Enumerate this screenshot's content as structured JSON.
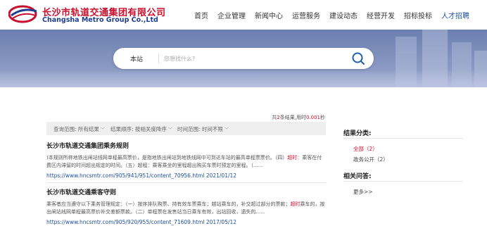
{
  "header": {
    "logo_cn": "长沙市轨道交通集团有限公司",
    "logo_en": "Changsha Metro Group Co.,Ltd",
    "nav": [
      {
        "label": "首页",
        "active": false
      },
      {
        "label": "企业管理",
        "active": false
      },
      {
        "label": "新闻中心",
        "active": false
      },
      {
        "label": "运营服务",
        "active": false
      },
      {
        "label": "建设动态",
        "active": false
      },
      {
        "label": "经营开发",
        "active": false
      },
      {
        "label": "招标投标",
        "active": false
      },
      {
        "label": "人才招聘",
        "active": true
      }
    ]
  },
  "search": {
    "scope": "本站",
    "placeholder": "您想找什么?",
    "button_icon": "search-icon"
  },
  "results_meta": {
    "prefix": "共",
    "count": "2",
    "middle": "条结果,用时",
    "time": "0.001",
    "suffix": "秒"
  },
  "filters": [
    {
      "label": "查询范围:",
      "value": "所有结果"
    },
    {
      "label": "结果顺序:",
      "value": "按相关度降序"
    },
    {
      "label": "时间范围:",
      "value": "时间不限"
    }
  ],
  "results": [
    {
      "title": "长沙市轨道交通集团乘务规则",
      "snippet_parts": [
        {
          "text": ")本规则所称地铁出闸站线网单程最高票价，是指地铁出闸站到地铁线网中可到达车站的最高单程票票价。（四）",
          "hl": false
        },
        {
          "text": "超时",
          "hl": true
        },
        {
          "text": "：乘客在付费区内滞留的时间超出规定的时间。（五）超程：乘客乘坐的里程超出购买车票时预定的里程。（......",
          "hl": false
        }
      ],
      "url": "https://www.hncsmtr.com/905/941/951/content_70956.html",
      "date": "2021/01/12"
    },
    {
      "title": "长沙市轨道交通乘客守则",
      "snippet_parts": [
        {
          "text": "乘客者应当遵守以下乘务管理规定：（一）按序排队购票、持有效车票乘车；越站乘车的，补交超过部分的票款；",
          "hl": false
        },
        {
          "text": "超时",
          "hl": true
        },
        {
          "text": "乘车的，按出闸站线网单程最高票价补交差额票款。（二）单程票在发售站当日乘车有效，出站回收，遗失的......",
          "hl": false
        }
      ],
      "url": "https://www.hncsmtr.com/905/920/955/content_71609.html",
      "date": "2017/05/12"
    }
  ],
  "sidebar": {
    "category_title": "结果分类:",
    "categories": [
      {
        "label": "全部",
        "count": "（2）",
        "active": true
      },
      {
        "label": "政务公开",
        "count": "（2）",
        "active": false
      }
    ],
    "related_title": "相关问答:",
    "more": "更多>>"
  },
  "colors": {
    "brand_red": "#c8102e",
    "brand_blue": "#1e3f8f",
    "link": "#1e4fa0",
    "banner": "#7d8fbd"
  }
}
